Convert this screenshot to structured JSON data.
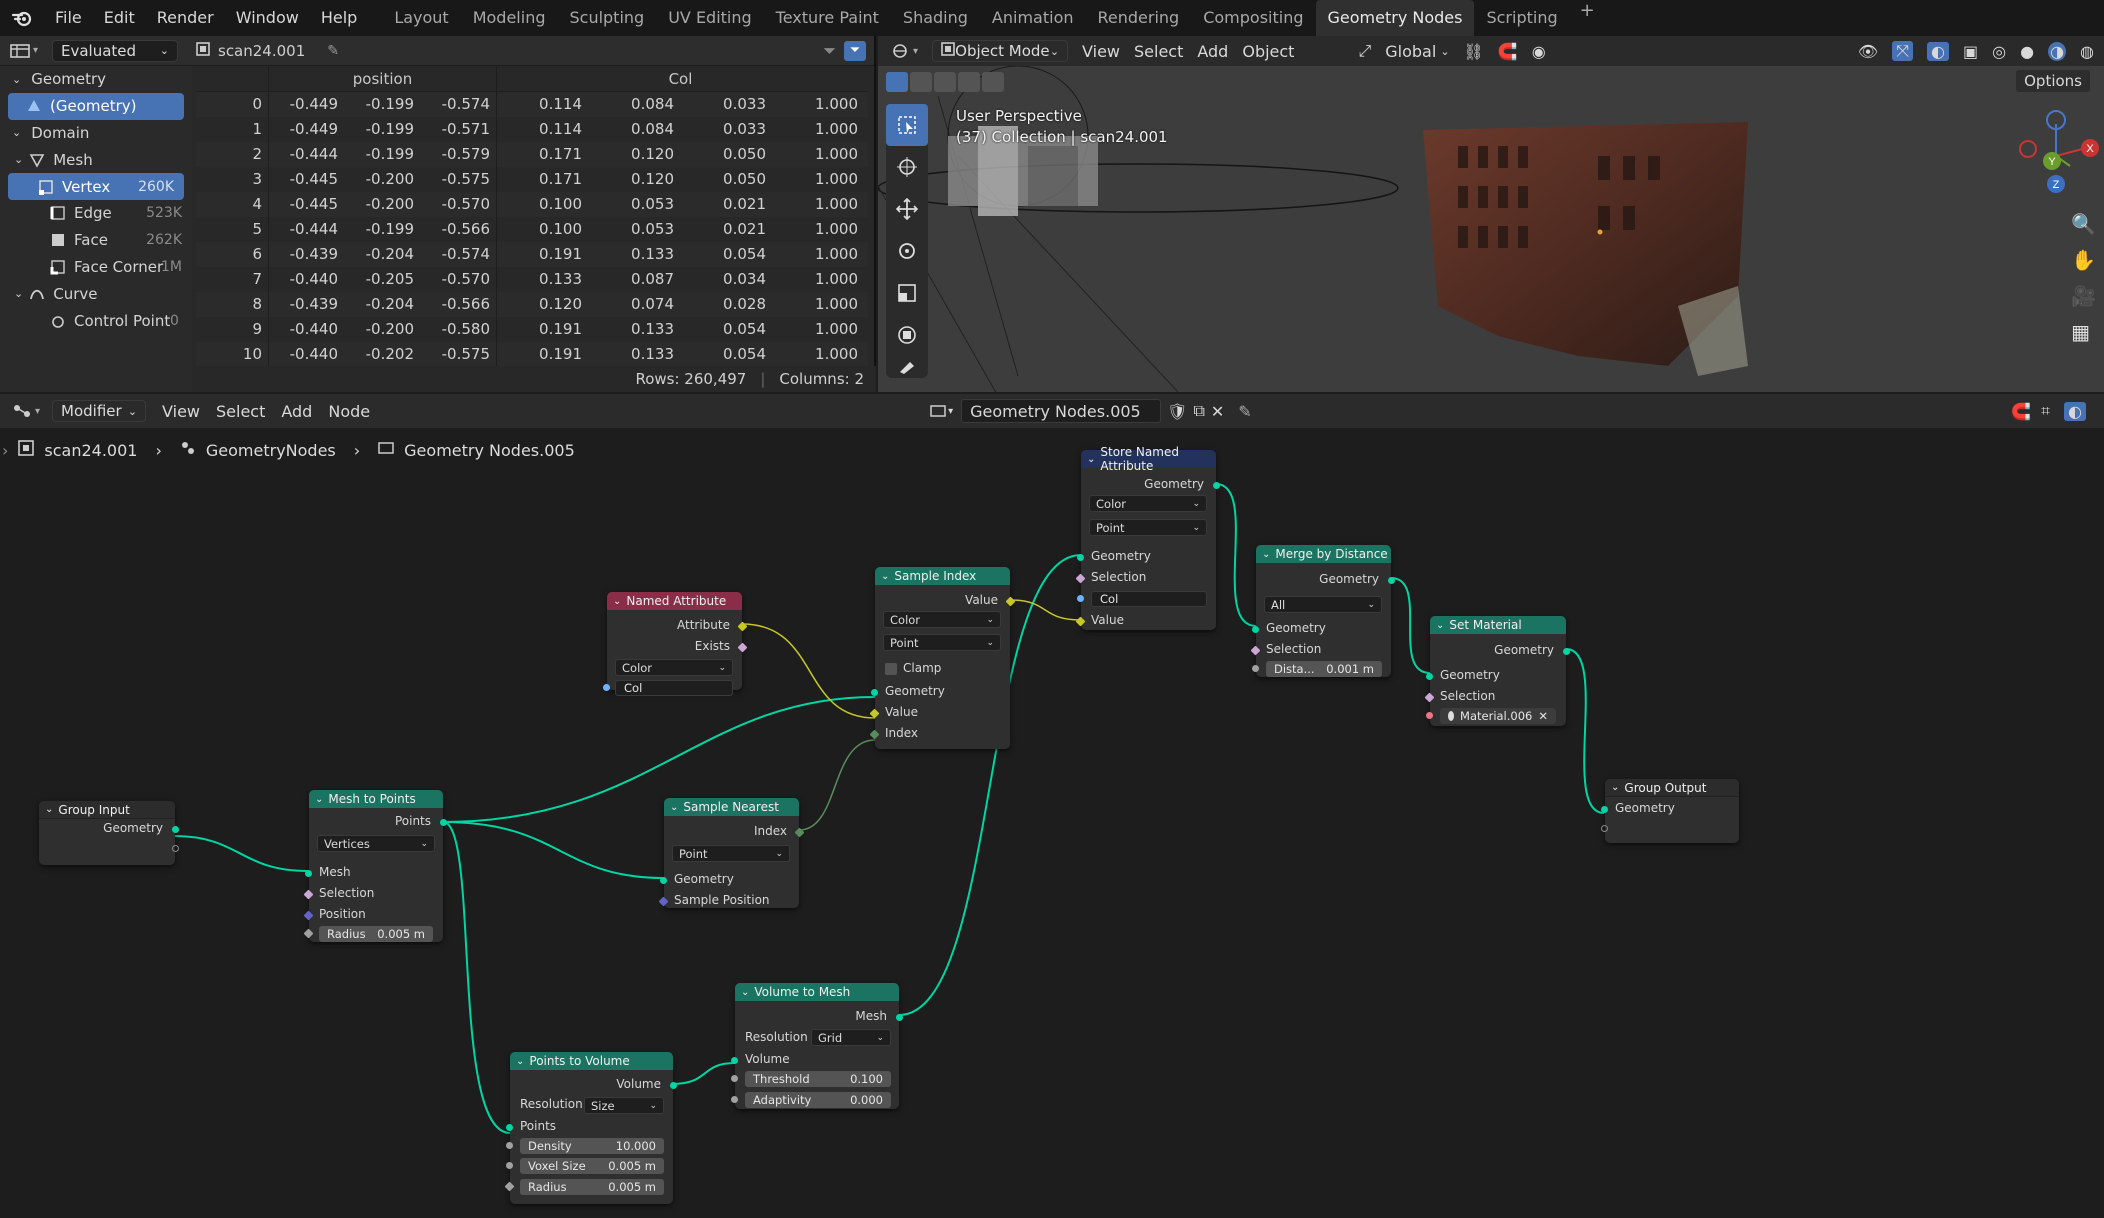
{
  "menu": [
    "File",
    "Edit",
    "Render",
    "Window",
    "Help"
  ],
  "workspaces": [
    "Layout",
    "Modeling",
    "Sculpting",
    "UV Editing",
    "Texture Paint",
    "Shading",
    "Animation",
    "Rendering",
    "Compositing",
    "Geometry Nodes",
    "Scripting"
  ],
  "active_workspace": "Geometry Nodes",
  "spreadsheet": {
    "mode": "Evaluated",
    "object": "scan24.001",
    "tree": {
      "geometry_label": "Geometry",
      "geometry_item": "(Geometry)",
      "domain_label": "Domain",
      "mesh_label": "Mesh",
      "vertex": "Vertex",
      "vertex_count": "260K",
      "edge": "Edge",
      "edge_count": "523K",
      "face": "Face",
      "face_count": "262K",
      "face_corner": "Face Corner",
      "face_corner_count": "1M",
      "curve_label": "Curve",
      "control_point": "Control Point",
      "control_point_count": "0"
    },
    "columns": [
      "position",
      "Col"
    ],
    "rows": [
      [
        "0",
        "-0.449",
        "-0.199",
        "-0.574",
        "0.114",
        "0.084",
        "0.033",
        "1.000"
      ],
      [
        "1",
        "-0.449",
        "-0.199",
        "-0.571",
        "0.114",
        "0.084",
        "0.033",
        "1.000"
      ],
      [
        "2",
        "-0.444",
        "-0.199",
        "-0.579",
        "0.171",
        "0.120",
        "0.050",
        "1.000"
      ],
      [
        "3",
        "-0.445",
        "-0.200",
        "-0.575",
        "0.171",
        "0.120",
        "0.050",
        "1.000"
      ],
      [
        "4",
        "-0.445",
        "-0.200",
        "-0.570",
        "0.100",
        "0.053",
        "0.021",
        "1.000"
      ],
      [
        "5",
        "-0.444",
        "-0.199",
        "-0.566",
        "0.100",
        "0.053",
        "0.021",
        "1.000"
      ],
      [
        "6",
        "-0.439",
        "-0.204",
        "-0.574",
        "0.191",
        "0.133",
        "0.054",
        "1.000"
      ],
      [
        "7",
        "-0.440",
        "-0.205",
        "-0.570",
        "0.133",
        "0.087",
        "0.034",
        "1.000"
      ],
      [
        "8",
        "-0.439",
        "-0.204",
        "-0.566",
        "0.120",
        "0.074",
        "0.028",
        "1.000"
      ],
      [
        "9",
        "-0.440",
        "-0.200",
        "-0.580",
        "0.191",
        "0.133",
        "0.054",
        "1.000"
      ],
      [
        "10",
        "-0.440",
        "-0.202",
        "-0.575",
        "0.191",
        "0.133",
        "0.054",
        "1.000"
      ]
    ],
    "rows_label": "Rows: 260,497",
    "columns_label": "Columns: 2"
  },
  "viewport": {
    "mode": "Object Mode",
    "menus": [
      "View",
      "Select",
      "Add",
      "Object"
    ],
    "orientation": "Global",
    "options": "Options",
    "info_line1": "User Perspective",
    "info_line2": "(37) Collection | scan24.001",
    "axis_x": "X",
    "axis_y": "Y",
    "axis_z": "Z"
  },
  "node_editor": {
    "editor_type": "Modifier",
    "menus": [
      "View",
      "Select",
      "Add",
      "Node"
    ],
    "tree_name": "Geometry Nodes.005",
    "breadcrumb": [
      "scan24.001",
      "GeometryNodes",
      "Geometry Nodes.005"
    ],
    "nodes": {
      "group_input": {
        "title": "Group Input",
        "out_geometry": "Geometry"
      },
      "mesh_to_points": {
        "title": "Mesh to Points",
        "out_points": "Points",
        "mode": "Vertices",
        "in_mesh": "Mesh",
        "in_selection": "Selection",
        "in_position": "Position",
        "radius_label": "Radius",
        "radius_value": "0.005 m"
      },
      "named_attribute": {
        "title": "Named Attribute",
        "out_attribute": "Attribute",
        "out_exists": "Exists",
        "type": "Color",
        "name": "Col"
      },
      "sample_nearest": {
        "title": "Sample Nearest",
        "out_index": "Index",
        "domain": "Point",
        "in_geometry": "Geometry",
        "in_sample_position": "Sample Position"
      },
      "sample_index": {
        "title": "Sample Index",
        "out_value": "Value",
        "type": "Color",
        "domain": "Point",
        "clamp": "Clamp",
        "in_geometry": "Geometry",
        "in_value": "Value",
        "in_index": "Index"
      },
      "store_named": {
        "title": "Store Named Attribute",
        "out_geometry": "Geometry",
        "type": "Color",
        "domain": "Point",
        "in_geometry": "Geometry",
        "in_selection": "Selection",
        "name": "Col",
        "in_value": "Value"
      },
      "merge_by_distance": {
        "title": "Merge by Distance",
        "out_geometry": "Geometry",
        "mode": "All",
        "in_geometry": "Geometry",
        "in_selection": "Selection",
        "dist_label": "Dista...",
        "dist_value": "0.001 m"
      },
      "set_material": {
        "title": "Set Material",
        "out_geometry": "Geometry",
        "in_geometry": "Geometry",
        "in_selection": "Selection",
        "material": "Material.006"
      },
      "group_output": {
        "title": "Group Output",
        "in_geometry": "Geometry"
      },
      "points_to_volume": {
        "title": "Points to Volume",
        "out_volume": "Volume",
        "resolution_label": "Resolution",
        "resolution_mode": "Size",
        "in_points": "Points",
        "density_label": "Density",
        "density_value": "10.000",
        "voxel_label": "Voxel Size",
        "voxel_value": "0.005 m",
        "radius_label": "Radius",
        "radius_value": "0.005 m"
      },
      "volume_to_mesh": {
        "title": "Volume to Mesh",
        "out_mesh": "Mesh",
        "resolution_label": "Resolution",
        "resolution_mode": "Grid",
        "in_volume": "Volume",
        "threshold_label": "Threshold",
        "threshold_value": "0.100",
        "adaptivity_label": "Adaptivity",
        "adaptivity_value": "0.000"
      }
    }
  },
  "colors": {
    "accent": "#4772b3",
    "geometry_node_header": "#1b7361",
    "attribute_node_header": "#8a2d49",
    "geometry_socket": "#00d6a3",
    "color_socket": "#c7c729"
  }
}
